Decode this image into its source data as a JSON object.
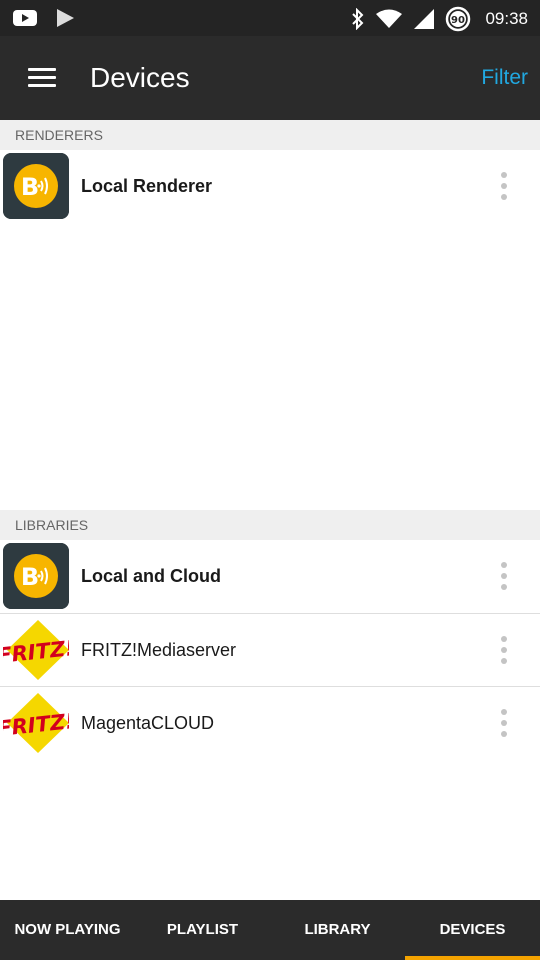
{
  "status_bar": {
    "time": "09:38",
    "battery_level": "90",
    "icons": [
      "youtube-icon",
      "play-store-icon",
      "bluetooth-icon",
      "wifi-icon",
      "signal-icon",
      "battery-icon"
    ]
  },
  "toolbar": {
    "title": "Devices",
    "filter_label": "Filter"
  },
  "renderers": {
    "header": "RENDERERS",
    "items": [
      {
        "name": "Local Renderer",
        "logo": "bubbleupnp-logo"
      }
    ]
  },
  "libraries": {
    "header": "LIBRARIES",
    "items": [
      {
        "name": "Local and Cloud",
        "logo": "bubbleupnp-logo"
      },
      {
        "name": "FRITZ!Mediaserver",
        "logo": "fritz-logo",
        "logo_text": "FRITZ!"
      },
      {
        "name": "MagentaCLOUD",
        "logo": "fritz-logo",
        "logo_text": "FRITZ!"
      }
    ]
  },
  "bottom_nav": {
    "tabs": [
      "NOW PLAYING",
      "PLAYLIST",
      "LIBRARY",
      "DEVICES"
    ],
    "active": "DEVICES"
  },
  "colors": {
    "accent": "#f4a300",
    "filter_link": "#21a8e0",
    "toolbar_bg": "#2b2b2b",
    "status_bar_bg": "#242424"
  }
}
